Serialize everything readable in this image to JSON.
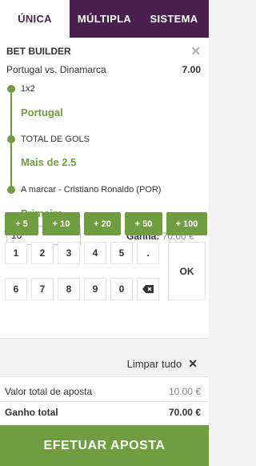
{
  "tabs": [
    {
      "label": "ÚNICA"
    },
    {
      "label": "MÚLTIPLA"
    },
    {
      "label": "SISTEMA"
    }
  ],
  "bet": {
    "title": "BET BUILDER",
    "close_icon": "close-icon",
    "match": "Portugal vs. Dinamarca",
    "odds": "7.00",
    "legs": [
      {
        "market": "1x2",
        "selection": "Portugal"
      },
      {
        "market": "TOTAL DE GOLS",
        "selection": "Mais de 2.5"
      },
      {
        "market": "A marcar - Cristiano Ronaldo (POR)",
        "selection": "Primeiro"
      }
    ],
    "stake_value": "10",
    "ganha_label": "Ganha:",
    "ganha_value": "70.00 €"
  },
  "quick_stakes": [
    "+ 5",
    "+ 10",
    "+ 20",
    "+ 50",
    "+ 100"
  ],
  "keypad": {
    "row1": [
      "1",
      "2",
      "3",
      "4",
      "5",
      "."
    ],
    "row2": [
      "6",
      "7",
      "8",
      "9",
      "0"
    ],
    "backspace_icon": "backspace-icon",
    "ok_label": "OK"
  },
  "clear_all": {
    "label": "Limpar tudo",
    "icon": "close-icon"
  },
  "summary": {
    "total_stake_label": "Valor total de aposta",
    "total_stake_value": "10.00 €",
    "total_win_label": "Ganho total",
    "total_win_value": "70.00 €"
  },
  "submit_label": "EFETUAR APOSTA",
  "colors": {
    "brand_purple": "#4a1f50",
    "accent_green": "#6e9e3f"
  }
}
